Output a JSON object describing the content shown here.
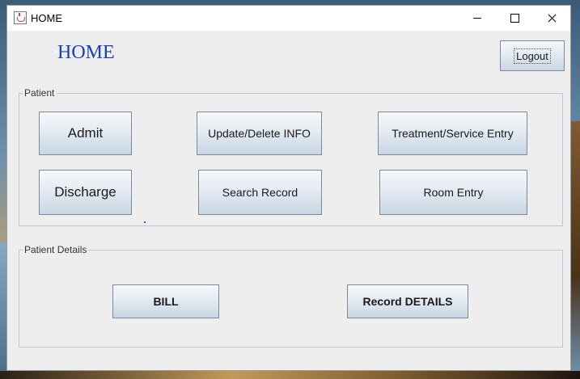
{
  "window": {
    "title": "HOME"
  },
  "header": {
    "heading": "HOME",
    "logout_label": "Logout"
  },
  "patient": {
    "legend": "Patient",
    "buttons": {
      "admit": "Admit",
      "update": "Update/Delete INFO",
      "treatment": "Treatment/Service Entry",
      "discharge": "Discharge",
      "search": "Search Record",
      "room": "Room Entry"
    }
  },
  "details": {
    "legend": "Patient Details",
    "buttons": {
      "bill": "BILL",
      "record": "Record DETAILS"
    }
  },
  "colors": {
    "heading": "#1a3fb5",
    "window_bg": "#eeeeee",
    "group_border": "#b8c8d8"
  }
}
